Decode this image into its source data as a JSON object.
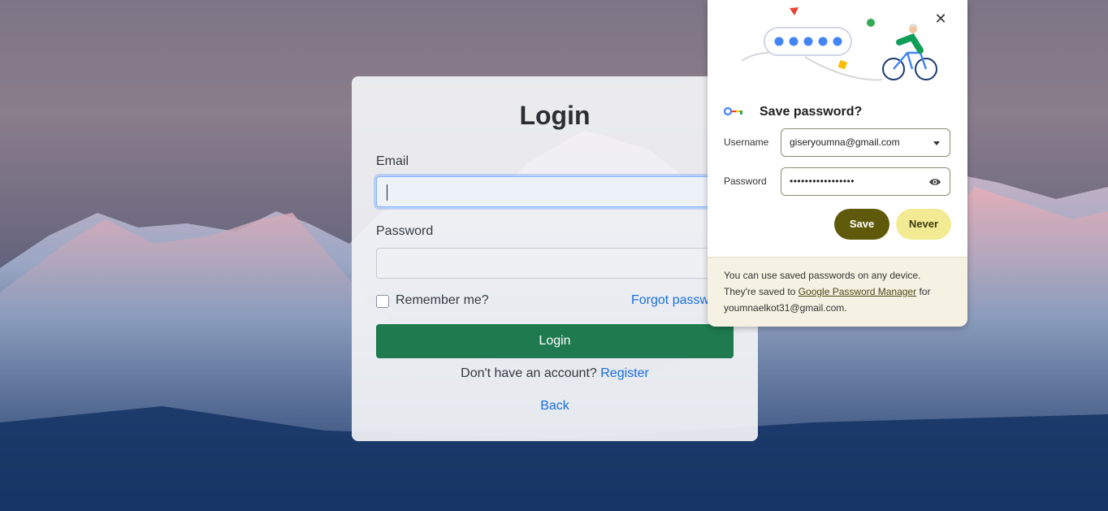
{
  "login": {
    "title": "Login",
    "email_label": "Email",
    "password_label": "Password",
    "remember_label": "Remember me?",
    "forgot_label": "Forgot passw",
    "login_button": "Login",
    "no_account_text": "Don't have an account?",
    "register_link": "Register",
    "back_link": "Back"
  },
  "popup": {
    "title": "Save password?",
    "username_label": "Username",
    "username_value": "giseryoumna@gmail.com",
    "password_label": "Password",
    "password_value": "•••••••••••••••••",
    "save_button": "Save",
    "never_button": "Never",
    "footer_pre": "You can use saved passwords on any device. They're saved to",
    "footer_link": "Google Password Manager",
    "footer_post": "for youmnaelkot31@gmail.com.",
    "close_icon": "close-icon",
    "key_icon": "key-icon",
    "eye_icon": "eye-icon"
  },
  "colors": {
    "login_green": "#1f7a4f",
    "link_blue": "#1a6fe0",
    "save_olive": "#5e5a09",
    "never_yellow": "#f2eb93"
  }
}
